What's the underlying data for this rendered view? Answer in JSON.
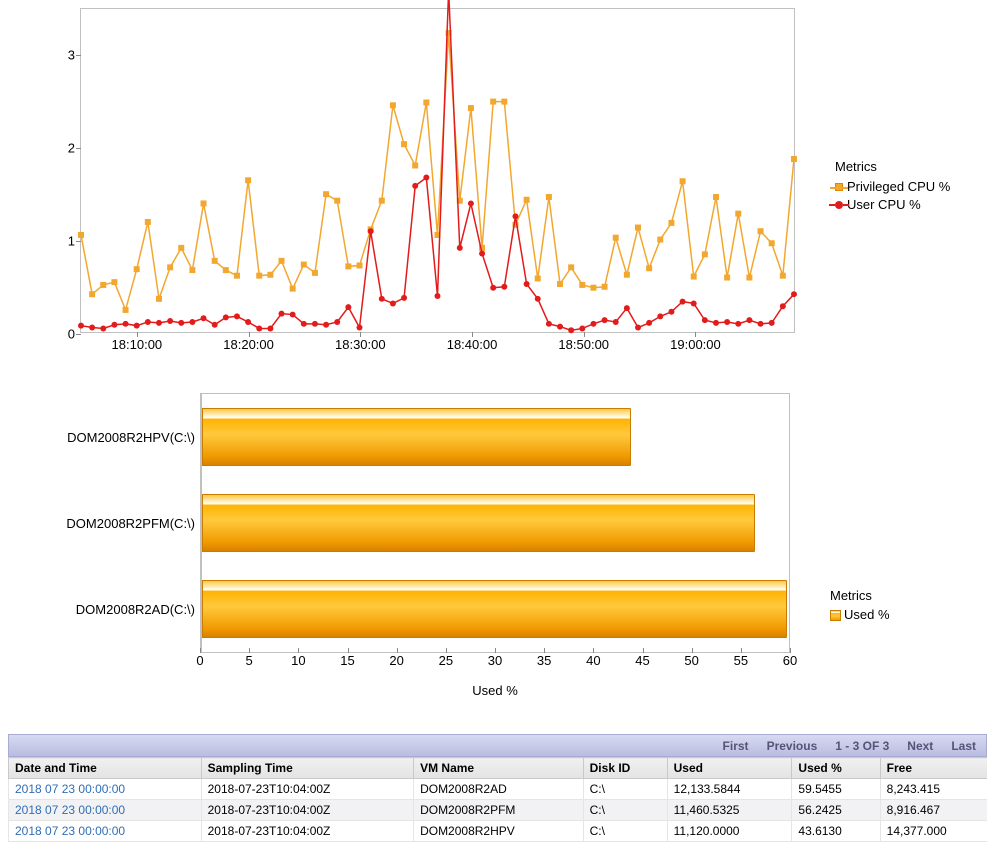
{
  "chart_data": [
    {
      "type": "line",
      "legend_title": "Metrics",
      "xlabel": "",
      "ylabel": "",
      "ylim": [
        0,
        3.5
      ],
      "y_ticks": [
        0,
        1,
        2,
        3
      ],
      "x_categories": [
        "18:10:00",
        "18:20:00",
        "18:30:00",
        "18:40:00",
        "18:50:00",
        "19:00:00"
      ],
      "series": [
        {
          "name": "Privileged CPU %",
          "color": "#F2A72E",
          "marker": "square",
          "values": [
            1.06,
            0.42,
            0.52,
            0.55,
            0.25,
            0.69,
            1.2,
            0.37,
            0.71,
            0.92,
            0.68,
            1.4,
            0.78,
            0.68,
            0.62,
            1.65,
            0.62,
            0.63,
            0.78,
            0.48,
            0.74,
            0.65,
            1.5,
            1.43,
            0.72,
            0.73,
            1.12,
            1.43,
            2.46,
            2.04,
            1.81,
            2.49,
            1.06,
            3.24,
            1.43,
            2.43,
            0.92,
            2.5,
            2.5,
            1.17,
            1.44,
            0.59,
            1.47,
            0.53,
            0.71,
            0.52,
            0.49,
            0.5,
            1.03,
            0.63,
            1.14,
            0.7,
            1.01,
            1.19,
            1.64,
            0.61,
            0.85,
            1.47,
            0.6,
            1.29,
            0.6,
            1.1,
            0.97,
            0.62,
            1.88
          ]
        },
        {
          "name": "User CPU %",
          "color": "#E21B1B",
          "marker": "circle",
          "values": [
            0.08,
            0.06,
            0.05,
            0.09,
            0.1,
            0.08,
            0.12,
            0.11,
            0.13,
            0.11,
            0.12,
            0.16,
            0.09,
            0.17,
            0.18,
            0.12,
            0.05,
            0.05,
            0.21,
            0.2,
            0.1,
            0.1,
            0.09,
            0.12,
            0.28,
            0.06,
            1.1,
            0.37,
            0.32,
            0.38,
            1.59,
            1.68,
            0.4,
            3.7,
            0.92,
            1.4,
            0.86,
            0.49,
            0.5,
            1.26,
            0.53,
            0.37,
            0.1,
            0.07,
            0.03,
            0.05,
            0.1,
            0.14,
            0.12,
            0.27,
            0.06,
            0.11,
            0.18,
            0.23,
            0.34,
            0.32,
            0.14,
            0.11,
            0.12,
            0.1,
            0.14,
            0.1,
            0.11,
            0.29,
            0.42
          ]
        }
      ]
    },
    {
      "type": "bar",
      "orientation": "horizontal",
      "legend_title": "Metrics",
      "xlabel": "Used %",
      "xlim": [
        0,
        60
      ],
      "x_ticks": [
        0,
        5,
        10,
        15,
        20,
        25,
        30,
        35,
        40,
        45,
        50,
        55,
        60
      ],
      "categories": [
        "DOM2008R2HPV(C:\\)",
        "DOM2008R2PFM(C:\\)",
        "DOM2008R2AD(C:\\)"
      ],
      "series": [
        {
          "name": "Used %",
          "color": "#F2A72E",
          "values": [
            43.6,
            56.2,
            59.5
          ]
        }
      ]
    }
  ],
  "pager": {
    "first": "First",
    "prev": "Previous",
    "range": "1 - 3 OF 3",
    "next": "Next",
    "last": "Last"
  },
  "table": {
    "columns": [
      "Date and Time",
      "Sampling Time",
      "VM Name",
      "Disk ID",
      "Used",
      "Used %",
      "Free"
    ],
    "rows": [
      {
        "date": "2018 07 23 00:00:00",
        "samp": "2018-07-23T10:04:00Z",
        "vm": "DOM2008R2AD",
        "disk": "C:\\",
        "used": "12,133.5844",
        "usedp": "59.5455",
        "free": "8,243.415"
      },
      {
        "date": "2018 07 23 00:00:00",
        "samp": "2018-07-23T10:04:00Z",
        "vm": "DOM2008R2PFM",
        "disk": "C:\\",
        "used": "11,460.5325",
        "usedp": "56.2425",
        "free": "8,916.467"
      },
      {
        "date": "2018 07 23 00:00:00",
        "samp": "2018-07-23T10:04:00Z",
        "vm": "DOM2008R2HPV",
        "disk": "C:\\",
        "used": "11,120.0000",
        "usedp": "43.6130",
        "free": "14,377.000"
      }
    ]
  }
}
